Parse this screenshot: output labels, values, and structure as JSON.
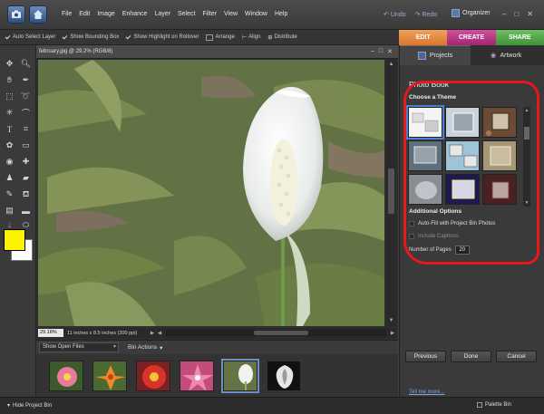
{
  "menubar": {
    "items": [
      "File",
      "Edit",
      "Image",
      "Enhance",
      "Layer",
      "Select",
      "Filter",
      "View",
      "Window",
      "Help"
    ],
    "undo_label": "Undo",
    "redo_label": "Redo",
    "organizer_label": "Organizer"
  },
  "options_bar": {
    "auto_select_layer": "Auto Select Layer",
    "show_bounding_box": "Show Bounding Box",
    "show_highlight": "Show Highlight on Rollover",
    "arrange": "Arrange",
    "align": "Align",
    "distribute": "Distribute"
  },
  "mode_tabs": {
    "edit": "EDIT",
    "create": "CREATE",
    "share": "SHARE"
  },
  "colors": {
    "foreground": "#fff200",
    "background": "#ffffff",
    "edit_tab": "#e3893d",
    "create_tab": "#b83484",
    "share_tab": "#56a84b",
    "highlight_circle": "#e8171c"
  },
  "document": {
    "title": "february.jpg @ 29.2% (RGB/8)",
    "zoom": "29.18%",
    "doc_size": "11 inches x 8.5 inches (200 ppi)"
  },
  "project_bin": {
    "show_label": "Show Open Files",
    "bin_actions": "Bin Actions",
    "thumbnails": [
      "pink-flower",
      "orange-lily",
      "red-flower",
      "pink-lily",
      "white-peace-lily",
      "black-white-flower"
    ]
  },
  "bottombar": {
    "hide_project_bin": "Hide Project Bin",
    "palette_bin": "Palette Bin"
  },
  "right_panel": {
    "tabs": [
      "Projects",
      "Artwork"
    ],
    "title": "Photo Book",
    "choose_theme": "Choose a Theme",
    "additional_options": "Additional Options",
    "autofill": "Auto-Fill with Project Bin Photos",
    "include_captions": "Include Captions",
    "number_of_pages_label": "Number of Pages",
    "number_of_pages_value": "20",
    "buttons": {
      "previous": "Previous",
      "done": "Done",
      "cancel": "Cancel"
    },
    "tell_me_more": "Tell me more..."
  }
}
